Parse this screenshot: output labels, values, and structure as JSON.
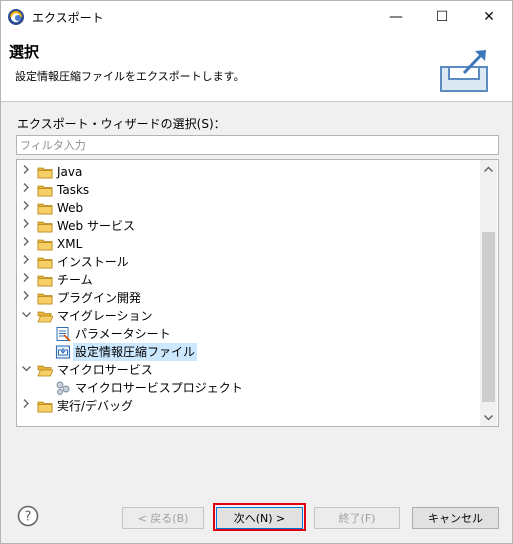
{
  "window": {
    "title": "エクスポート",
    "minimize_glyph": "—",
    "maximize_glyph": "☐",
    "close_glyph": "✕"
  },
  "banner": {
    "title": "選択",
    "description": "設定情報圧縮ファイルをエクスポートします。"
  },
  "wizard_label": "エクスポート・ウィザードの選択(S)：",
  "filter": {
    "placeholder": "フィルタ入力",
    "value": ""
  },
  "tree": {
    "items": [
      {
        "label": "Java",
        "icon": "folder-icon",
        "expanded": false
      },
      {
        "label": "Tasks",
        "icon": "folder-icon",
        "expanded": false
      },
      {
        "label": "Web",
        "icon": "folder-icon",
        "expanded": false
      },
      {
        "label": "Web サービス",
        "icon": "folder-icon",
        "expanded": false
      },
      {
        "label": "XML",
        "icon": "folder-icon",
        "expanded": false
      },
      {
        "label": "インストール",
        "icon": "folder-icon",
        "expanded": false
      },
      {
        "label": "チーム",
        "icon": "folder-icon",
        "expanded": false
      },
      {
        "label": "プラグイン開発",
        "icon": "folder-icon",
        "expanded": false
      },
      {
        "label": "マイグレーション",
        "icon": "folder-open-icon",
        "expanded": true
      },
      {
        "label": "パラメータシート",
        "icon": "parameter-sheet-icon"
      },
      {
        "label": "設定情報圧縮ファイル",
        "icon": "archive-file-icon",
        "selected": true
      },
      {
        "label": "マイクロサービス",
        "icon": "folder-open-icon",
        "expanded": true
      },
      {
        "label": "マイクロサービスプロジェクト",
        "icon": "microservice-project-icon"
      },
      {
        "label": "実行/デバッグ",
        "icon": "folder-icon",
        "expanded": false
      }
    ]
  },
  "buttons": {
    "back": "< 戻る(B)",
    "next": "次へ(N) >",
    "finish": "終了(F)",
    "cancel": "キャンセル"
  },
  "colors": {
    "selection": "#cce8ff",
    "highlight_border": "#e00012",
    "folder": "#e8b33c",
    "accent": "#0078d7"
  }
}
